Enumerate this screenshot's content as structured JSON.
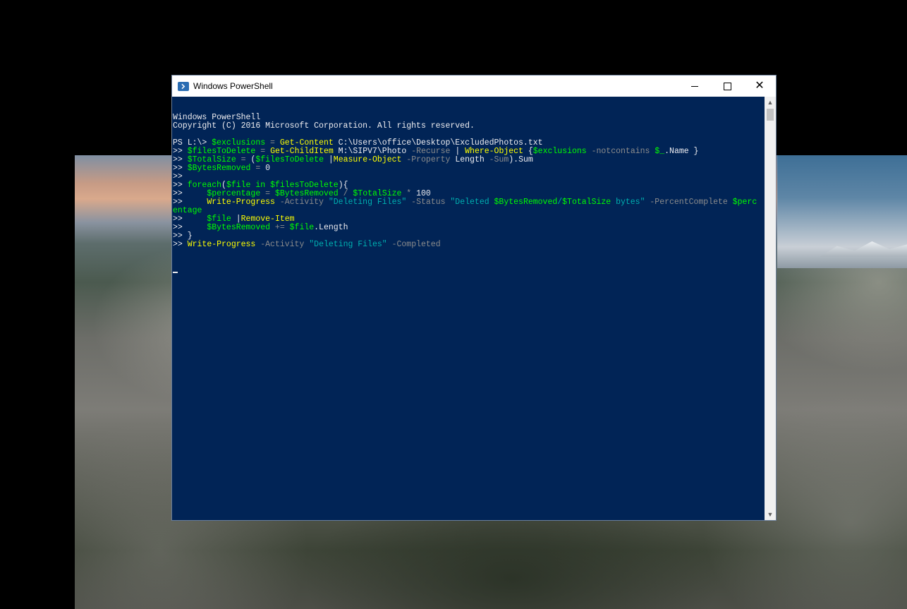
{
  "window": {
    "title": "Windows PowerShell",
    "buttons": {
      "minimize": "minimize",
      "maximize": "maximize",
      "close": "✕"
    }
  },
  "console": {
    "lines": [
      [
        {
          "t": "Windows PowerShell",
          "c": "plain"
        }
      ],
      [
        {
          "t": "Copyright (C) 2016 Microsoft Corporation. All rights reserved.",
          "c": "plain"
        }
      ],
      [],
      [
        {
          "t": "PS L:\\> ",
          "c": "plain"
        },
        {
          "t": "$exclusions",
          "c": "var"
        },
        {
          "t": " = ",
          "c": "op"
        },
        {
          "t": "Get-Content",
          "c": "cmd"
        },
        {
          "t": " C:\\Users\\office\\Desktop\\ExcludedPhotos.txt",
          "c": "plain"
        }
      ],
      [
        {
          "t": ">> ",
          "c": "plain"
        },
        {
          "t": "$filesToDelete",
          "c": "var"
        },
        {
          "t": " = ",
          "c": "op"
        },
        {
          "t": "Get-ChildItem",
          "c": "cmd"
        },
        {
          "t": " M:\\SIPV7\\Photo ",
          "c": "plain"
        },
        {
          "t": "-Recurse",
          "c": "prm"
        },
        {
          "t": " | ",
          "c": "plain"
        },
        {
          "t": "Where-Object",
          "c": "cmd"
        },
        {
          "t": " {",
          "c": "plain"
        },
        {
          "t": "$exclusions",
          "c": "var"
        },
        {
          "t": " -notcontains ",
          "c": "prm"
        },
        {
          "t": "$_",
          "c": "var"
        },
        {
          "t": ".Name }",
          "c": "plain"
        }
      ],
      [
        {
          "t": ">> ",
          "c": "plain"
        },
        {
          "t": "$TotalSize",
          "c": "var"
        },
        {
          "t": " = ",
          "c": "op"
        },
        {
          "t": "(",
          "c": "plain"
        },
        {
          "t": "$filesToDelete",
          "c": "var"
        },
        {
          "t": " |",
          "c": "plain"
        },
        {
          "t": "Measure-Object",
          "c": "cmd"
        },
        {
          "t": " -Property",
          "c": "prm"
        },
        {
          "t": " Length ",
          "c": "plain"
        },
        {
          "t": "-Sum",
          "c": "prm"
        },
        {
          "t": ").Sum",
          "c": "plain"
        }
      ],
      [
        {
          "t": ">> ",
          "c": "plain"
        },
        {
          "t": "$BytesRemoved",
          "c": "var"
        },
        {
          "t": " = ",
          "c": "op"
        },
        {
          "t": "0",
          "c": "plain"
        }
      ],
      [
        {
          "t": ">>",
          "c": "plain"
        }
      ],
      [
        {
          "t": ">> ",
          "c": "plain"
        },
        {
          "t": "foreach",
          "c": "var"
        },
        {
          "t": "(",
          "c": "plain"
        },
        {
          "t": "$file",
          "c": "var"
        },
        {
          "t": " in ",
          "c": "var"
        },
        {
          "t": "$filesToDelete",
          "c": "var"
        },
        {
          "t": "){",
          "c": "plain"
        }
      ],
      [
        {
          "t": ">>     ",
          "c": "plain"
        },
        {
          "t": "$percentage",
          "c": "var"
        },
        {
          "t": " = ",
          "c": "op"
        },
        {
          "t": "$BytesRemoved",
          "c": "var"
        },
        {
          "t": " / ",
          "c": "op"
        },
        {
          "t": "$TotalSize",
          "c": "var"
        },
        {
          "t": " * ",
          "c": "op"
        },
        {
          "t": "100",
          "c": "plain"
        }
      ],
      [
        {
          "t": ">>     ",
          "c": "plain"
        },
        {
          "t": "Write-Progress",
          "c": "cmd"
        },
        {
          "t": " -Activity ",
          "c": "prm"
        },
        {
          "t": "\"Deleting Files\"",
          "c": "str"
        },
        {
          "t": " -Status ",
          "c": "prm"
        },
        {
          "t": "\"Deleted ",
          "c": "str"
        },
        {
          "t": "$BytesRemoved",
          "c": "var"
        },
        {
          "t": "/",
          "c": "str"
        },
        {
          "t": "$TotalSize",
          "c": "var"
        },
        {
          "t": " bytes\"",
          "c": "str"
        },
        {
          "t": " -PercentComplete ",
          "c": "prm"
        },
        {
          "t": "$perc",
          "c": "var"
        }
      ],
      [
        {
          "t": "entage",
          "c": "var"
        }
      ],
      [
        {
          "t": ">>     ",
          "c": "plain"
        },
        {
          "t": "$file",
          "c": "var"
        },
        {
          "t": " |",
          "c": "plain"
        },
        {
          "t": "Remove-Item",
          "c": "cmd"
        }
      ],
      [
        {
          "t": ">>     ",
          "c": "plain"
        },
        {
          "t": "$BytesRemoved",
          "c": "var"
        },
        {
          "t": " += ",
          "c": "op"
        },
        {
          "t": "$file",
          "c": "var"
        },
        {
          "t": ".Length",
          "c": "plain"
        }
      ],
      [
        {
          "t": ">> }",
          "c": "plain"
        }
      ],
      [
        {
          "t": ">> ",
          "c": "plain"
        },
        {
          "t": "Write-Progress",
          "c": "cmd"
        },
        {
          "t": " -Activity ",
          "c": "prm"
        },
        {
          "t": "\"Deleting Files\"",
          "c": "str"
        },
        {
          "t": " -Completed",
          "c": "prm"
        }
      ]
    ]
  },
  "scrollbar": {
    "up_arrow": "▲",
    "down_arrow": "▼"
  },
  "colors": {
    "console_background": "#012456",
    "command": "#ffff00",
    "variable": "#00ff00",
    "string": "#00b0b0",
    "parameter": "#8c8c8c",
    "text": "#eeedf0"
  }
}
